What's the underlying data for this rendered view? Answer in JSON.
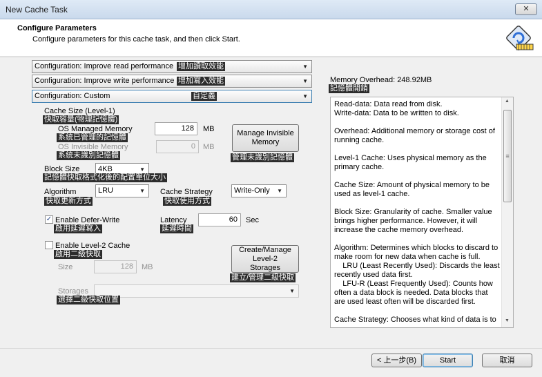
{
  "window": {
    "title": "New Cache Task",
    "close_glyph": "✕"
  },
  "header": {
    "title": "Configure Parameters",
    "subtitle": "Configure parameters for this cache task, and then click Start."
  },
  "presets": [
    {
      "label": "Configuration: Improve read performance",
      "annotation": "增加讀取效能"
    },
    {
      "label": "Configuration: Improve write performance",
      "annotation": "增加寫入效能"
    },
    {
      "label": "Configuration: Custom",
      "annotation": "自定義"
    }
  ],
  "cache_size": {
    "label": "Cache Size (Level-1)",
    "label_ann": "快取容量(物理記憶體)",
    "os_managed_label": "OS Managed Memory",
    "os_managed_ann": "系統已管理的記憶體",
    "os_managed_value": "128",
    "os_managed_unit": "MB",
    "os_invisible_label": "OS Invisible Memory",
    "os_invisible_ann": "系統未識別記憶體",
    "os_invisible_value": "0",
    "os_invisible_unit": "MB"
  },
  "manage_invisible": {
    "label": "Manage Invisible Memory",
    "annotation": "管理未識別記憶體"
  },
  "block_size": {
    "label": "Block Size",
    "value": "4KB",
    "annotation": "記憶體快取格式化後的配置單位大小"
  },
  "algorithm": {
    "label": "Algorithm",
    "value": "LRU",
    "annotation": "快取更新方式"
  },
  "cache_strategy": {
    "label": "Cache Strategy",
    "value": "Write-Only",
    "annotation": "快取使用方式"
  },
  "defer_write": {
    "label": "Enable Defer-Write",
    "checked": true,
    "check_glyph": "✓",
    "annotation": "啟用延遲寫入"
  },
  "latency": {
    "label": "Latency",
    "value": "60",
    "unit": "Sec",
    "annotation": "延遲時間"
  },
  "level2": {
    "label": "Enable Level-2 Cache",
    "checked": false,
    "annotation": "啟用二級快取",
    "size_label": "Size",
    "size_value": "128",
    "size_unit": "MB",
    "storages_label": "Storages",
    "storages_ann": "選擇二級快取位置"
  },
  "manage_level2": {
    "label": "Create/Manage Level-2 Storages",
    "annotation": "建立/管理二級快取"
  },
  "memory_overhead": {
    "label": "Memory Overhead: 248.92MB",
    "annotation": "記憶體開銷"
  },
  "info_text": "Read-data: Data read from disk.\nWrite-data: Data to be written to disk.\n\nOverhead: Additional memory or storage cost of running cache.\n\nLevel-1 Cache: Uses physical memory as the primary cache.\n\nCache Size: Amount of physical memory to be used as level-1 cache.\n\nBlock Size: Granularity of cache. Smaller value brings higher performance. However, it will increase the cache memory overhead.\n\nAlgorithm: Determines which blocks to discard to make room for new data when cache is full.\n    LRU (Least Recently Used): Discards the least recently used data first.\n    LFU-R (Least Frequently Used): Counts how often a data block is needed. Data blocks that are used least often will be discarded first.\n\nCache Strategy: Chooses what kind of data is to",
  "footer": {
    "back": "< 上一步(B)",
    "start": "Start",
    "cancel": "取消"
  },
  "colors": {
    "annotation_bg": "#2d2d2d",
    "titlebar": "#c9d9ec",
    "accent_icon": "#2f6fd6"
  }
}
